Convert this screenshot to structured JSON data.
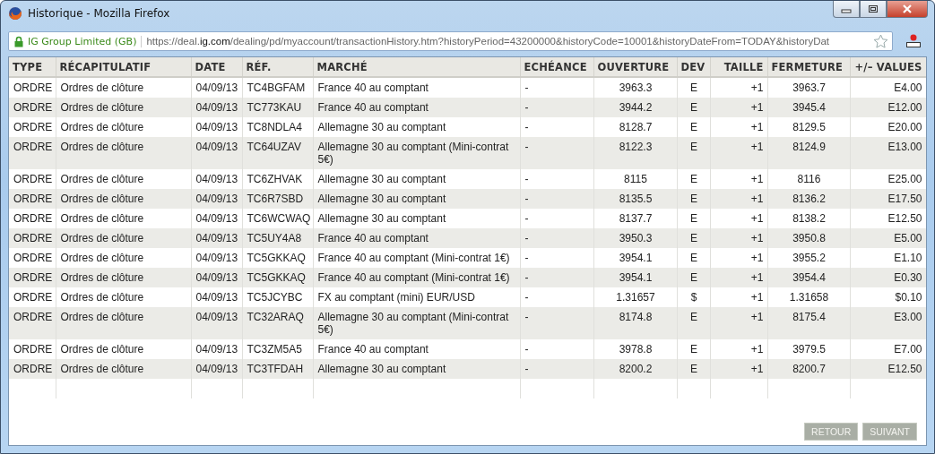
{
  "window": {
    "title": "Historique - Mozilla Firefox"
  },
  "address_bar": {
    "identity": "IG Group Limited (GB)",
    "url_prefix": "https://deal.",
    "url_domain": "ig.com",
    "url_rest": "/dealing/pd/myaccount/transactionHistory.htm?historyPeriod=43200000&historyCode=10001&historyDateFrom=TODAY&historyDat"
  },
  "table": {
    "columns": [
      "TYPE",
      "RÉCAPITULATIF",
      "DATE",
      "RÉF.",
      "MARCHÉ",
      "ECHÉANCE",
      "OUVERTURE",
      "DEV",
      "TAILLE",
      "FERMETURE",
      "+/– VALUES"
    ],
    "rows": [
      [
        "ORDRE",
        "Ordres de clôture",
        "04/09/13",
        "TC4BGFAM",
        "France 40 au comptant",
        "-",
        "3963.3",
        "E",
        "+1",
        "3963.7",
        "E4.00"
      ],
      [
        "ORDRE",
        "Ordres de clôture",
        "04/09/13",
        "TC773KAU",
        "France 40 au comptant",
        "-",
        "3944.2",
        "E",
        "+1",
        "3945.4",
        "E12.00"
      ],
      [
        "ORDRE",
        "Ordres de clôture",
        "04/09/13",
        "TC8NDLA4",
        "Allemagne 30 au comptant",
        "-",
        "8128.7",
        "E",
        "+1",
        "8129.5",
        "E20.00"
      ],
      [
        "ORDRE",
        "Ordres de clôture",
        "04/09/13",
        "TC64UZAV",
        "Allemagne 30 au comptant (Mini-contrat 5€)",
        "-",
        "8122.3",
        "E",
        "+1",
        "8124.9",
        "E13.00"
      ],
      [
        "ORDRE",
        "Ordres de clôture",
        "04/09/13",
        "TC6ZHVAK",
        "Allemagne 30 au comptant",
        "-",
        "8115",
        "E",
        "+1",
        "8116",
        "E25.00"
      ],
      [
        "ORDRE",
        "Ordres de clôture",
        "04/09/13",
        "TC6R7SBD",
        "Allemagne 30 au comptant",
        "-",
        "8135.5",
        "E",
        "+1",
        "8136.2",
        "E17.50"
      ],
      [
        "ORDRE",
        "Ordres de clôture",
        "04/09/13",
        "TC6WCWAQ",
        "Allemagne 30 au comptant",
        "-",
        "8137.7",
        "E",
        "+1",
        "8138.2",
        "E12.50"
      ],
      [
        "ORDRE",
        "Ordres de clôture",
        "04/09/13",
        "TC5UY4A8",
        "France 40 au comptant",
        "-",
        "3950.3",
        "E",
        "+1",
        "3950.8",
        "E5.00"
      ],
      [
        "ORDRE",
        "Ordres de clôture",
        "04/09/13",
        "TC5GKKAQ",
        "France 40 au comptant (Mini-contrat 1€)",
        "-",
        "3954.1",
        "E",
        "+1",
        "3955.2",
        "E1.10"
      ],
      [
        "ORDRE",
        "Ordres de clôture",
        "04/09/13",
        "TC5GKKAQ",
        "France 40 au comptant (Mini-contrat 1€)",
        "-",
        "3954.1",
        "E",
        "+1",
        "3954.4",
        "E0.30"
      ],
      [
        "ORDRE",
        "Ordres de clôture",
        "04/09/13",
        "TC5JCYBC",
        "FX au comptant (mini) EUR/USD",
        "-",
        "1.31657",
        "$",
        "+1",
        "1.31658",
        "$0.10"
      ],
      [
        "ORDRE",
        "Ordres de clôture",
        "04/09/13",
        "TC32ARAQ",
        "Allemagne 30 au comptant (Mini-contrat 5€)",
        "-",
        "8174.8",
        "E",
        "+1",
        "8175.4",
        "E3.00"
      ],
      [
        "ORDRE",
        "Ordres de clôture",
        "04/09/13",
        "TC3ZM5A5",
        "France 40 au comptant",
        "-",
        "3978.8",
        "E",
        "+1",
        "3979.5",
        "E7.00"
      ],
      [
        "ORDRE",
        "Ordres de clôture",
        "04/09/13",
        "TC3TFDAH",
        "Allemagne 30 au comptant",
        "-",
        "8200.2",
        "E",
        "+1",
        "8200.7",
        "E12.50"
      ]
    ]
  },
  "buttons": [
    "RETOUR",
    "SUIVANT"
  ]
}
